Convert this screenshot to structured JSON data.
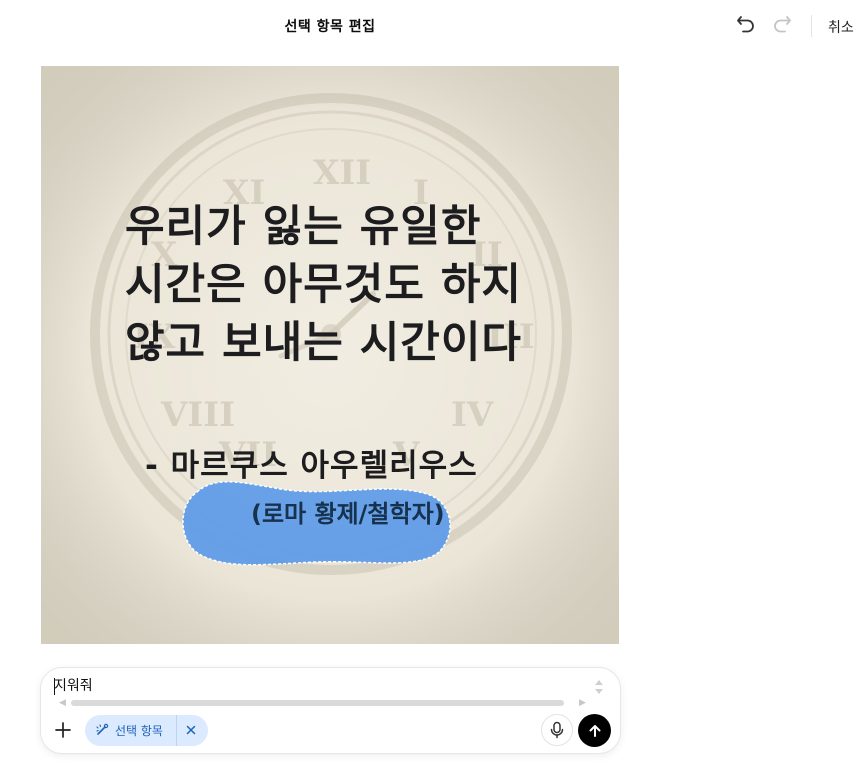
{
  "header": {
    "title": "선택 항목 편집",
    "undo_icon": "undo-icon",
    "redo_icon": "redo-icon",
    "cancel_label": "취소"
  },
  "image": {
    "quote_lines": [
      "우리가 잃는 유일한",
      "시간은 아무것도 하지",
      "않고 보내는 시간이다"
    ],
    "author": "- 마르쿠스 아우렐리우스",
    "subtitle": "(로마 황제/철학자)",
    "selection_color": "#5c9ae8",
    "background_color": "#ece7da"
  },
  "composer": {
    "prompt_value": "지워줘",
    "add_icon": "plus-icon",
    "chip": {
      "icon": "selection-brush-icon",
      "label": "선택 항목",
      "close_icon": "close-icon",
      "background": "#dbeafe",
      "text_color": "#1e63b8"
    },
    "mic_icon": "microphone-icon",
    "send_icon": "arrow-up-icon"
  }
}
